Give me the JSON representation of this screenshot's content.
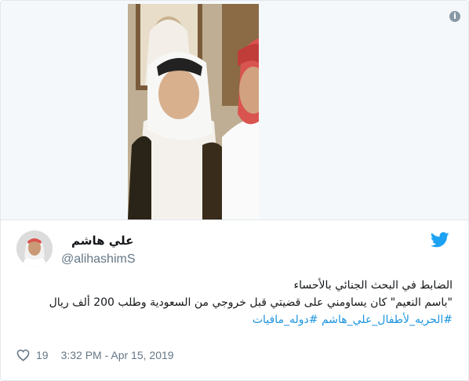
{
  "tweet": {
    "author_name": "علي هاشم",
    "handle": "@alihashimS",
    "text_lines": [
      "الضابط في البحث الجنائي بالأحساء",
      "\"باسم النعيم\" كان يساومني على قضيتي قبل خروجي من السعودية وطلب 200 ألف ريال"
    ],
    "hashtags": [
      "#الحريه_لأطفال_علي_هاشم",
      "#دوله_مافيات"
    ],
    "likes": "19",
    "timestamp": "3:32 PM - Apr 15, 2019"
  },
  "icons": {
    "info": "info-icon",
    "brand": "twitter-bird-icon",
    "like": "heart-icon"
  },
  "colors": {
    "brand": "#1da1f2",
    "hashtag": "#1b95e0",
    "muted": "#657786",
    "border": "#e1e8ed"
  }
}
